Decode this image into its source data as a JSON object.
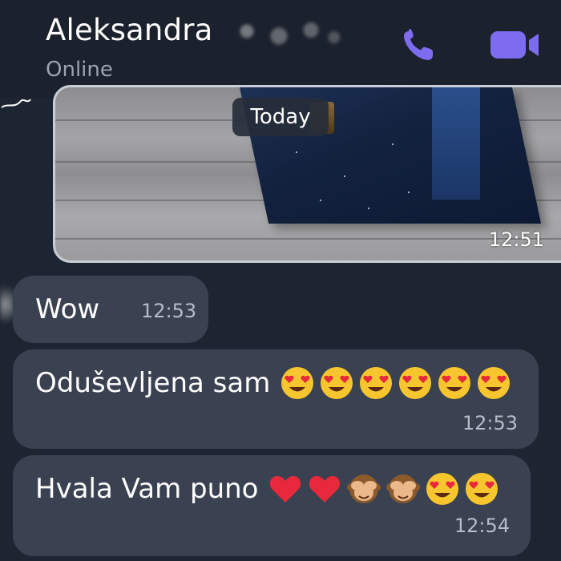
{
  "header": {
    "contact_name": "Aleksandra",
    "status": "Online",
    "accent_color": "#7d6cf0"
  },
  "media_message": {
    "date_chip": "Today",
    "time": "12:51"
  },
  "messages": [
    {
      "text": "Wow",
      "time": "12:53",
      "emojis": []
    },
    {
      "text": "Oduševljena sam",
      "time": "12:53",
      "emojis": [
        "heart-eyes-emoji",
        "heart-eyes-emoji",
        "heart-eyes-emoji",
        "heart-eyes-emoji",
        "heart-eyes-emoji",
        "heart-eyes-emoji"
      ]
    },
    {
      "text": "Hvala Vam puno",
      "time": "12:54",
      "emojis": [
        "red-heart-emoji",
        "red-heart-emoji",
        "see-no-evil-monkey-emoji",
        "see-no-evil-monkey-emoji",
        "heart-eyes-emoji",
        "heart-eyes-emoji"
      ]
    }
  ],
  "colors": {
    "background": "#1e2532",
    "header_background": "#1b212d",
    "bubble": "#3a4150",
    "time_text": "#b6bcc8"
  }
}
